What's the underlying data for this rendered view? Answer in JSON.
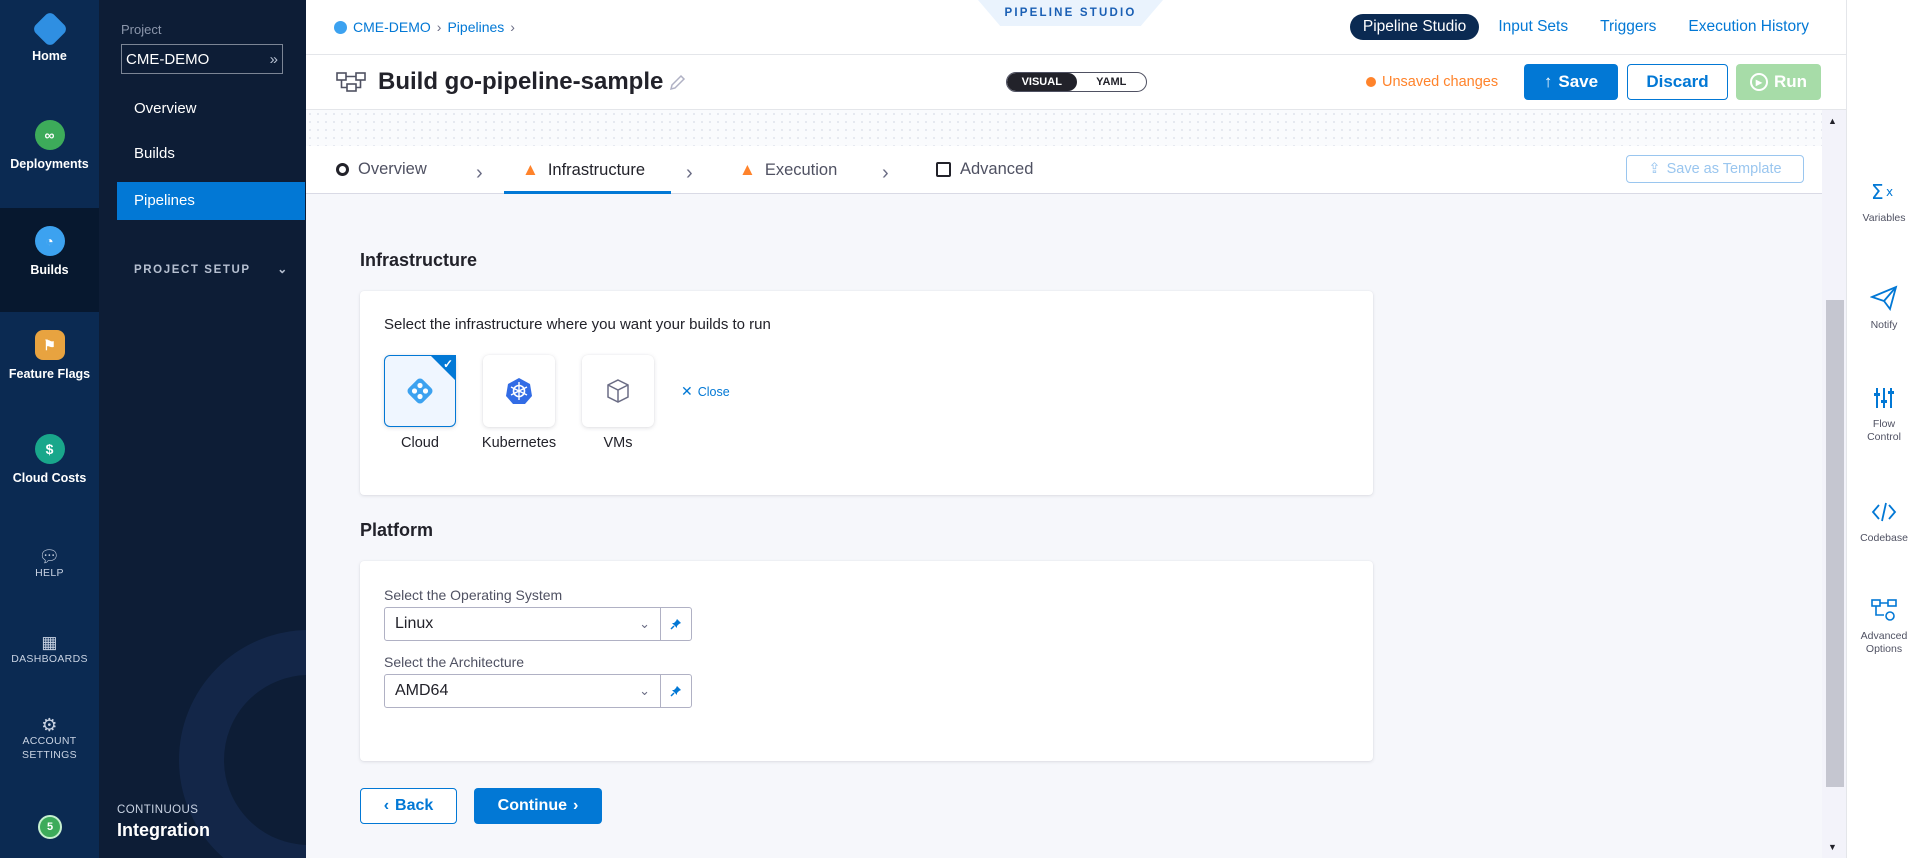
{
  "nav1": {
    "modules": [
      {
        "label": "Home",
        "icon": "home-icon"
      },
      {
        "label": "Deployments",
        "icon": "deployments-icon"
      },
      {
        "label": "Builds",
        "icon": "builds-icon"
      },
      {
        "label": "Feature Flags",
        "icon": "feature-flags-icon"
      },
      {
        "label": "Cloud Costs",
        "icon": "cloud-costs-icon"
      }
    ],
    "help": "HELP",
    "dashboards": "DASHBOARDS",
    "account_line1": "ACCOUNT",
    "account_line2": "SETTINGS",
    "notif_count": "5"
  },
  "nav2": {
    "project_label": "Project",
    "project_name": "CME-DEMO",
    "items": [
      "Overview",
      "Builds",
      "Pipelines"
    ],
    "project_setup": "PROJECT SETUP",
    "module_small": "CONTINUOUS",
    "module_big": "Integration"
  },
  "header": {
    "breadcrumb": [
      "CME-DEMO",
      "Pipelines"
    ],
    "studio_tag": "PIPELINE STUDIO",
    "tabs": [
      "Pipeline Studio",
      "Input Sets",
      "Triggers",
      "Execution History"
    ]
  },
  "titlebar": {
    "title": "Build go-pipeline-sample",
    "visual": "VISUAL",
    "yaml": "YAML",
    "unsaved": "Unsaved changes",
    "save": "Save",
    "discard": "Discard",
    "run": "Run"
  },
  "steps": {
    "items": [
      "Overview",
      "Infrastructure",
      "Execution",
      "Advanced"
    ],
    "save_template": "Save as Template"
  },
  "infra": {
    "heading": "Infrastructure",
    "lead": "Select the infrastructure where you want your builds to run",
    "options": [
      "Cloud",
      "Kubernetes",
      "VMs"
    ],
    "close": "Close"
  },
  "platform": {
    "heading": "Platform",
    "os_label": "Select the Operating System",
    "os_value": "Linux",
    "arch_label": "Select the Architecture",
    "arch_value": "AMD64"
  },
  "footer": {
    "back": "Back",
    "continue": "Continue"
  },
  "right_panel": {
    "variables": "Variables",
    "notify": "Notify",
    "flow1": "Flow",
    "flow2": "Control",
    "codebase": "Codebase",
    "adv1": "Advanced",
    "adv2": "Options"
  },
  "colors": {
    "accent": "#0278d5",
    "nav": "#0b2a52",
    "warning": "#ff832b",
    "run": "#a7dca8"
  }
}
